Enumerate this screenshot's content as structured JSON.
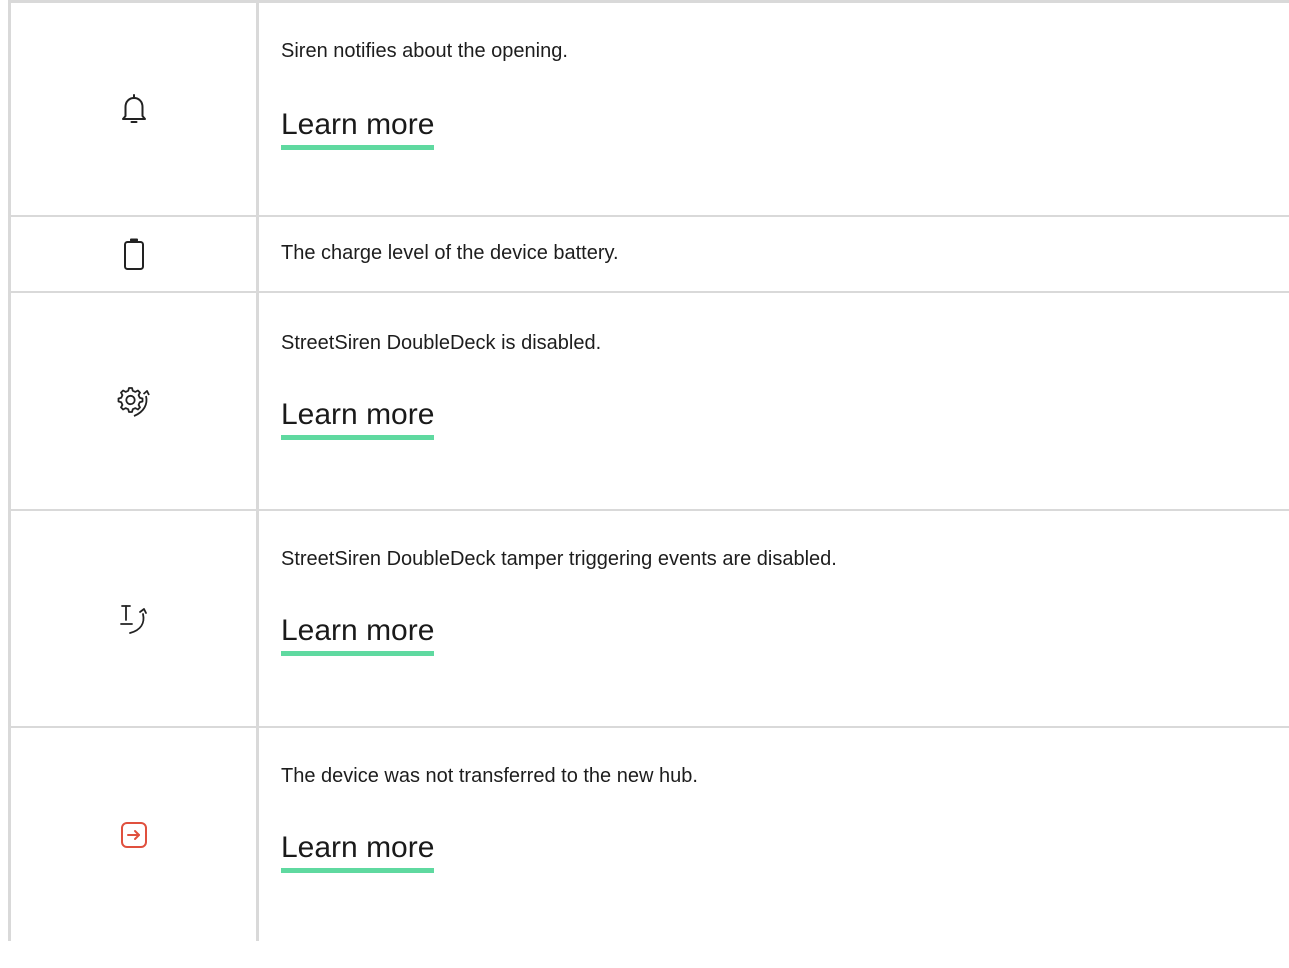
{
  "rows": [
    {
      "icon": "bell-icon",
      "description": "Siren notifies about the opening.",
      "link": "Learn more"
    },
    {
      "icon": "battery-icon",
      "description": "The charge level of the device battery."
    },
    {
      "icon": "device-disabled-gear-icon",
      "description": "StreetSiren DoubleDeck is disabled.",
      "link": "Learn more"
    },
    {
      "icon": "tamper-disabled-icon",
      "description": "StreetSiren DoubleDeck tamper triggering events are disabled.",
      "link": "Learn more"
    },
    {
      "icon": "transfer-failed-icon",
      "description": "The device was not transferred to the new hub.",
      "link": "Learn more"
    }
  ],
  "colors": {
    "border": "#d9d9d9",
    "text": "#1d1d1d",
    "link_underline": "#5fd9a0",
    "transfer_icon": "#e0503e"
  }
}
